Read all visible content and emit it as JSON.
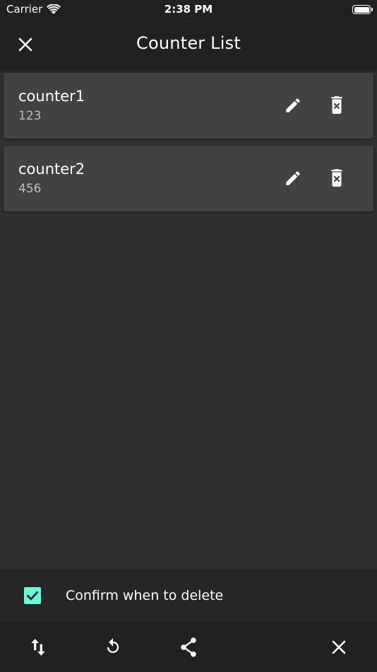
{
  "status_bar": {
    "carrier": "Carrier",
    "time": "2:38 PM"
  },
  "app_bar": {
    "title": "Counter List",
    "close_icon": "close-icon"
  },
  "counters": [
    {
      "name": "counter1",
      "value": "123"
    },
    {
      "name": "counter2",
      "value": "456"
    }
  ],
  "confirm": {
    "checked": true,
    "label": "Confirm when to delete"
  },
  "toolbar": {
    "icons": [
      "swap-vert-icon",
      "refresh-icon",
      "share-icon",
      "close-icon"
    ]
  },
  "colors": {
    "accent": "#64ffda",
    "background": "#303030",
    "card": "#424242",
    "bar": "#212121"
  }
}
